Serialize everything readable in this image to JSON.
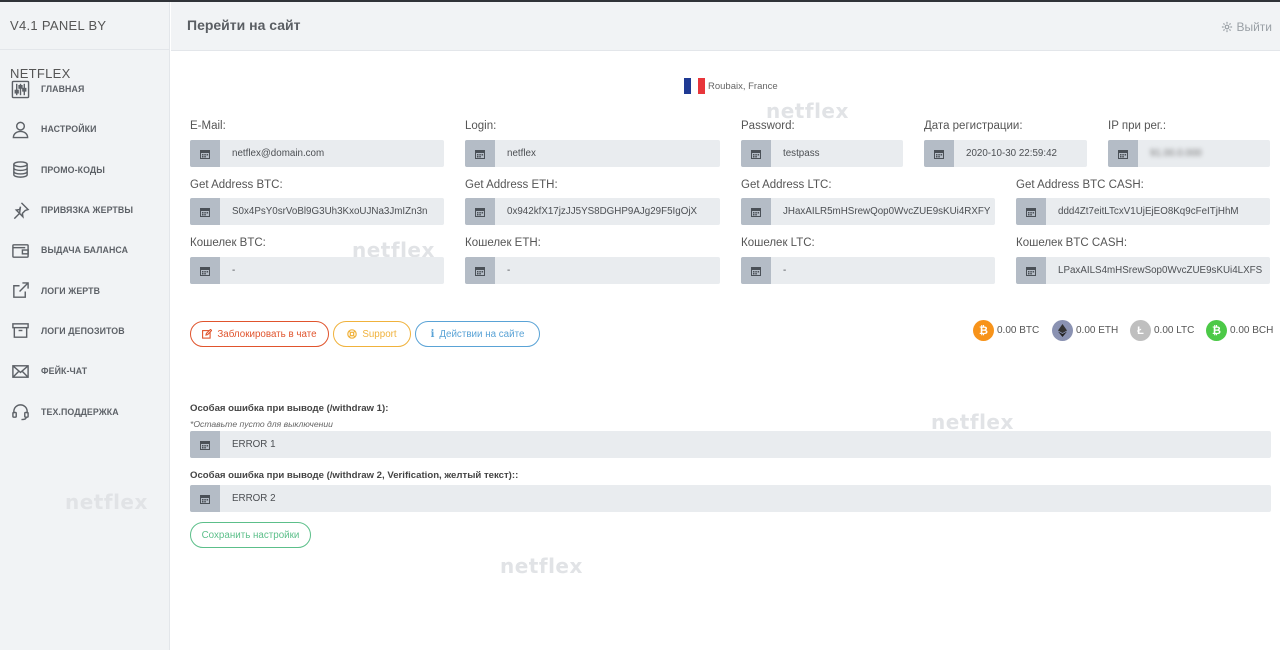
{
  "brand": "V4.1 PANEL BY NETFLEX",
  "header": {
    "title": "Перейти на сайт",
    "logout": "Выйти"
  },
  "sidebar": {
    "items": [
      {
        "label": "ГЛАВНАЯ",
        "icon": "sliders-icon"
      },
      {
        "label": "НАСТРОЙКИ",
        "icon": "user-icon"
      },
      {
        "label": "ПРОМО-КОДЫ",
        "icon": "database-icon"
      },
      {
        "label": "ПРИВЯЗКА ЖЕРТВЫ",
        "icon": "pin-icon"
      },
      {
        "label": "ВЫДАЧА БАЛАНСА",
        "icon": "wallet-icon"
      },
      {
        "label": "ЛОГИ ЖЕРТВ",
        "icon": "external-link-icon"
      },
      {
        "label": "ЛОГИ ДЕПОЗИТОВ",
        "icon": "archive-icon"
      },
      {
        "label": "ФЕЙК-ЧАТ",
        "icon": "mail-icon"
      },
      {
        "label": "ТЕХ.ПОДДЕРЖКА",
        "icon": "headset-icon"
      }
    ]
  },
  "watermark": "netflex",
  "location": "Roubaix, France",
  "fields": {
    "email": {
      "label": "E-Mail:",
      "value": "netflex@domain.com"
    },
    "login": {
      "label": "Login:",
      "value": "netflex"
    },
    "password": {
      "label": "Password:",
      "value": "testpass"
    },
    "regdate": {
      "label": "Дата регистрации:",
      "value": "2020-10-30 22:59:42"
    },
    "ip": {
      "label": "IP при рег.:",
      "value": "91.00.0.000"
    },
    "btc_addr": {
      "label": "Get Address BTC:",
      "value": "S0x4PsY0srVoBl9G3Uh3KxoUJNa3JmIZn3n"
    },
    "eth_addr": {
      "label": "Get Address ETH:",
      "value": "0x942kfX17jzJJ5YS8DGHP9AJg29F5IgOjX"
    },
    "ltc_addr": {
      "label": "Get Address LTC:",
      "value": "JHaxAILR5mHSrewQop0WvcZUE9sKUi4RXFY"
    },
    "bch_addr": {
      "label": "Get Address BTC CASH:",
      "value": "ddd4Zt7eitLTcxV1UjEjEO8Kq9cFeITjHhM"
    },
    "btc_wallet": {
      "label": "Кошелек BTC:",
      "value": "-"
    },
    "eth_wallet": {
      "label": "Кошелек ETH:",
      "value": "-"
    },
    "ltc_wallet": {
      "label": "Кошелек LTC:",
      "value": "-"
    },
    "bch_wallet": {
      "label": "Кошелек BTC CASH:",
      "value": "LPaxAILS4mHSrewSop0WvcZUE9sKUi4LXFS"
    }
  },
  "buttons": {
    "block": "Заблокировать в чате",
    "support": "Support",
    "actions": "Действии на сайте",
    "save": "Сохранить настройки"
  },
  "balances": [
    {
      "value": "0.00 BTC",
      "color": "#f7931a"
    },
    {
      "value": "0.00 ETH",
      "color": "#8a92b2"
    },
    {
      "value": "0.00 LTC",
      "color": "#bfbfbf"
    },
    {
      "value": "0.00 BCH",
      "color": "#4cc947"
    }
  ],
  "errors": {
    "e1_label": "Особая ошибка при выводе (/withdraw 1):",
    "e1_hint": "*Оставьте пусто для выключении",
    "e1_value": "ERROR 1",
    "e2_label": "Особая ошибка при выводе (/withdraw 2, Verification, желтый текст)::",
    "e2_value": "ERROR 2"
  },
  "colors": {
    "red": "#e0542d",
    "orange": "#f0b23c",
    "blue": "#5aa3d6",
    "green": "#5cbf8a"
  }
}
